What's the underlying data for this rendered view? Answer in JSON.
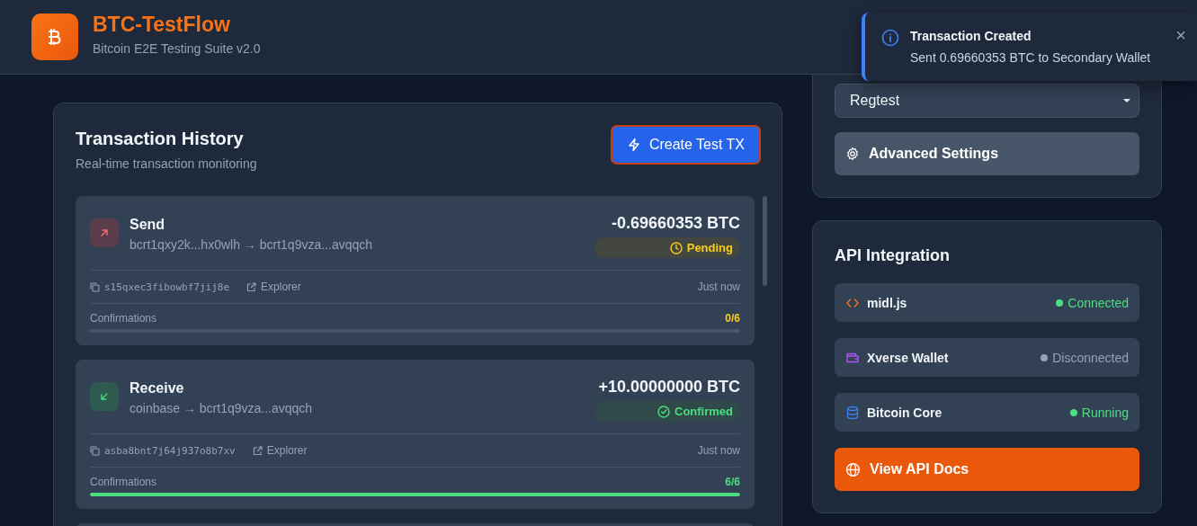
{
  "header": {
    "title": "BTC-TestFlow",
    "subtitle": "Bitcoin E2E Testing Suite v2.0"
  },
  "toast": {
    "title": "Transaction Created",
    "message": "Sent 0.69660353 BTC to Secondary Wallet",
    "close": "×"
  },
  "history": {
    "title": "Transaction History",
    "subtitle": "Real-time transaction monitoring",
    "button": "Create Test TX",
    "transactions": [
      {
        "kind": "send",
        "type": "Send",
        "route": "bcrt1qxy2k...hx0wlh → bcrt1q9vza...avqqch",
        "amount": "-0.69660353 BTC",
        "confirmed": false,
        "status_label": "Pending",
        "txid": "s15qxec3fibowbf7jij8e",
        "explorer": "Explorer",
        "time": "Just now",
        "confirmations_label": "Confirmations",
        "confirmations": "0/6",
        "level": 0
      },
      {
        "kind": "receive",
        "type": "Receive",
        "route": "coinbase → bcrt1q9vza...avqqch",
        "amount": "+10.00000000 BTC",
        "confirmed": true,
        "status_label": "Confirmed",
        "txid": "asba8bnt7j64j937o8b7xv",
        "explorer": "Explorer",
        "time": "Just now",
        "confirmations_label": "Confirmations",
        "confirmations": "6/6",
        "level": 1
      }
    ]
  },
  "network": {
    "value": "Regtest",
    "advanced_button": "Advanced Settings"
  },
  "api": {
    "title": "API Integration",
    "services": [
      {
        "kind": "code",
        "name": "midl.js",
        "status": "Connected",
        "color": "#4ade80"
      },
      {
        "kind": "wallet",
        "name": "Xverse Wallet",
        "status": "Disconnected",
        "color": "#94a3b8"
      },
      {
        "kind": "database",
        "name": "Bitcoin Core",
        "status": "Running",
        "color": "#4ade80"
      }
    ],
    "button": "View API Docs"
  }
}
